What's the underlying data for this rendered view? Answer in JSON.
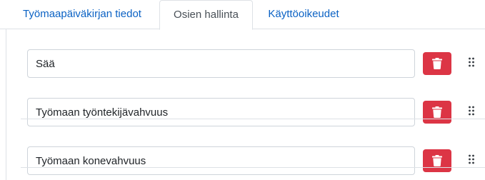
{
  "tabs": [
    {
      "label": "Työmaapäiväkirjan tiedot",
      "active": false
    },
    {
      "label": "Osien hallinta",
      "active": true
    },
    {
      "label": "Käyttöoikeudet",
      "active": false
    }
  ],
  "sections": [
    {
      "value": "Sää"
    },
    {
      "value": "Työmaan työntekijävahvuus"
    },
    {
      "value": "Työmaan konevahvuus"
    }
  ],
  "icons": {
    "delete": "trash-icon",
    "drag": "drag-handle-icon"
  },
  "colors": {
    "tab_link": "#0b62c4",
    "tab_active": "#495057",
    "delete_button": "#dc3545",
    "border": "#dee2e6"
  }
}
